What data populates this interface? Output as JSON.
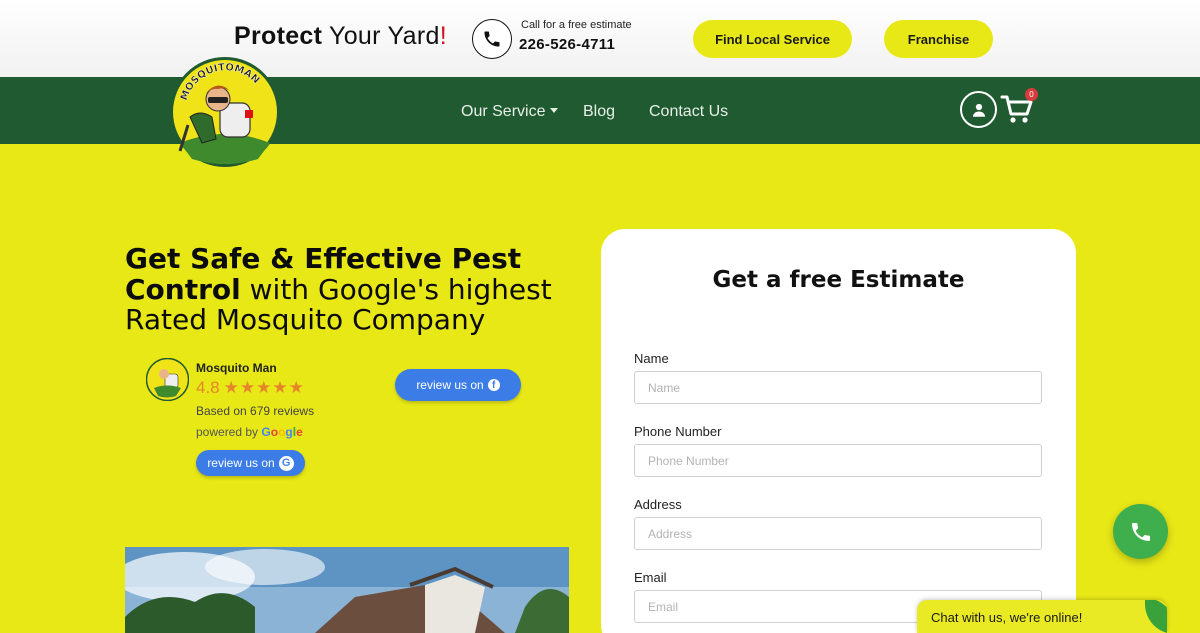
{
  "header": {
    "tagline_bold": "Protect",
    "tagline_rest": "Your Yard",
    "tagline_mark": "!",
    "call_label": "Call for a free estimate",
    "call_number": "226-526-4711",
    "buttons": {
      "find_local": "Find Local Service",
      "franchise": "Franchise"
    }
  },
  "nav": {
    "items": [
      "Our Service",
      "Blog",
      "Contact Us"
    ],
    "cart_count": "0"
  },
  "logo": {
    "text": "MOSQUITOMAN"
  },
  "hero": {
    "title_bold_1": "Get Safe & Effective Pest",
    "title_bold_2": "Control",
    "title_light_2": " with Google's highest",
    "title_light_3": "Rated Mosquito Company"
  },
  "review": {
    "name": "Mosquito Man",
    "rating": "4.8",
    "stars": "★★★★★",
    "based_on": "Based on 679 reviews",
    "powered_by": "powered by",
    "google_btn": "review us on",
    "facebook_btn": "review us on"
  },
  "form": {
    "title": "Get a free Estimate",
    "fields": [
      {
        "label": "Name",
        "placeholder": "Name"
      },
      {
        "label": "Phone Number",
        "placeholder": "Phone Number"
      },
      {
        "label": "Address",
        "placeholder": "Address"
      },
      {
        "label": "Email",
        "placeholder": "Email"
      }
    ]
  },
  "chat": {
    "text": "Chat with us, we're online!"
  },
  "colors": {
    "yellow": "#e8e817",
    "nav_green": "#1f5a30",
    "blue_button": "#3b7ce6",
    "call_green": "#3fae4c"
  }
}
